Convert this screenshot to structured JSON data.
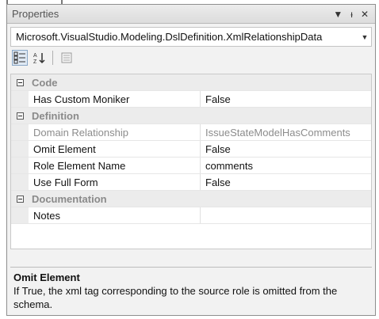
{
  "window": {
    "title": "Properties",
    "buttons": {
      "dropdown_icon": "dropdown-arrow-icon",
      "pin_icon": "pin-icon",
      "close_icon": "close-icon"
    }
  },
  "selector": {
    "value": "Microsoft.VisualStudio.Modeling.DslDefinition.XmlRelationshipData"
  },
  "toolbar": {
    "buttons": [
      "categorized-icon",
      "alphabetical-icon",
      "property-pages-icon"
    ]
  },
  "grid": {
    "categories": [
      {
        "name": "Code",
        "rows": [
          {
            "name": "Has Custom Moniker",
            "value": "False",
            "readonly": false
          }
        ]
      },
      {
        "name": "Definition",
        "rows": [
          {
            "name": "Domain Relationship",
            "value": "IssueStateModelHasComments",
            "readonly": true
          },
          {
            "name": "Omit Element",
            "value": "False",
            "readonly": false
          },
          {
            "name": "Role Element Name",
            "value": "comments",
            "readonly": false
          },
          {
            "name": "Use Full Form",
            "value": "False",
            "readonly": false
          }
        ]
      },
      {
        "name": "Documentation",
        "rows": [
          {
            "name": "Notes",
            "value": "",
            "readonly": false
          }
        ]
      }
    ]
  },
  "description": {
    "title": "Omit Element",
    "text": "If True, the xml tag corresponding to the source role is omitted from the schema."
  },
  "colors": {
    "category_text": "#8a8a8a",
    "readonly_text": "#8c8c8c",
    "panel_bg": "#f2f2f2",
    "grid_bg": "#ffffff"
  }
}
